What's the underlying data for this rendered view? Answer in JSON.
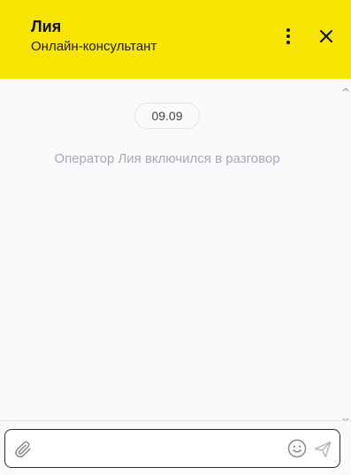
{
  "header": {
    "agent_name": "Лия",
    "agent_role": "Онлайн-консультант",
    "background_color": "#f8e600",
    "menu_icon": "more-vertical-icon",
    "close_icon": "close-icon"
  },
  "messages": {
    "date_label": "09.09",
    "system_message": "Оператор Лия включился в разговор"
  },
  "composer": {
    "placeholder": "",
    "value": "",
    "attach_icon": "paperclip-icon",
    "emoji_icon": "smiley-icon",
    "send_icon": "send-icon"
  }
}
